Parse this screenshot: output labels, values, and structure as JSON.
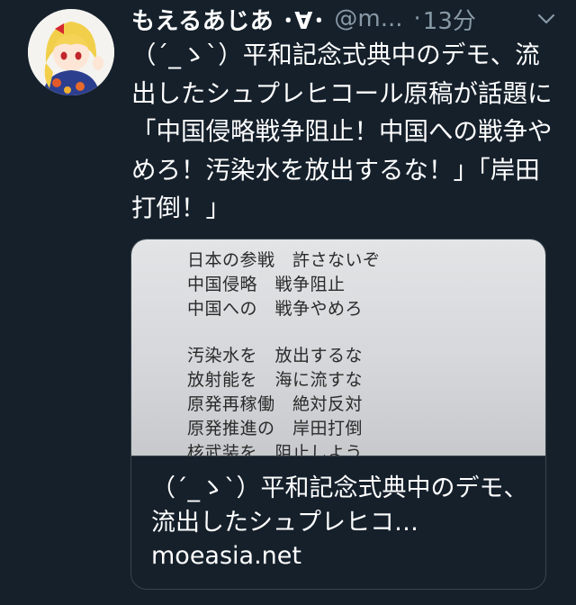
{
  "tweet": {
    "display_name": "もえるあじあ ･∀･",
    "handle": "@m...",
    "separator": "·",
    "time": "13分",
    "text": "（´_ゝ`）平和記念式典中のデモ、流出したシュプレヒコール原稿が話題に「中国侵略戦争阻止！中国への戦争やめろ！汚染水を放出するな！」「岸田打倒！」"
  },
  "card": {
    "image_lines": [
      "日本の参戦　許さないぞ",
      "中国侵略　戦争阻止",
      "中国への　戦争やめろ",
      "汚染水を　放出するな",
      "放射能を　海に流すな",
      "原発再稼働　絶対反対",
      "原発推進の　岸田打倒",
      "核武装を　阻止しよう"
    ],
    "title": "（´_ゝ`）平和記念式典中のデモ、流出したシュプレヒコ…",
    "domain": "moeasia.net"
  },
  "icons": {
    "more": "chevron-down-icon",
    "avatar": "avatar"
  },
  "colors": {
    "background": "#15202b",
    "secondary_text": "#8899a6",
    "border": "#38444d"
  }
}
